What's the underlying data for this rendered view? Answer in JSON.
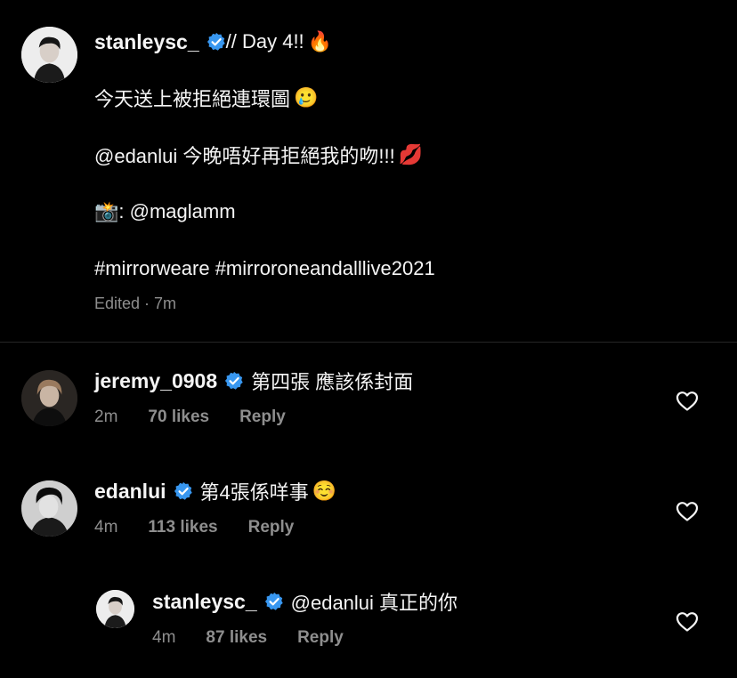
{
  "post": {
    "username": "stanleysc_",
    "title": " // Day 4!!",
    "title_emoji": "🔥",
    "line1": "今天送上被拒絕連環圖",
    "line1_emoji": "🥲",
    "line2": "@edanlui 今晚唔好再拒絕我的吻!!!",
    "line2_emoji": "💋",
    "line3_emoji": "📸",
    "line3": ": @maglamm",
    "hashtags": "#mirrorweare #mirroroneandalllive2021",
    "meta": "Edited · 7m"
  },
  "comments": [
    {
      "username": "jeremy_0908",
      "text": "第四張 應該係封面",
      "emoji": "",
      "time": "2m",
      "likes": "70 likes",
      "reply": "Reply"
    },
    {
      "username": "edanlui",
      "text": "第4張係咩事",
      "emoji": "☺️",
      "time": "4m",
      "likes": "113 likes",
      "reply": "Reply"
    },
    {
      "username": "stanleysc_",
      "text": "@edanlui 真正的你",
      "emoji": "",
      "time": "4m",
      "likes": "87 likes",
      "reply": "Reply"
    }
  ],
  "colors": {
    "background": "#000000",
    "text": "#f5f5f5",
    "muted": "#8e8e8e",
    "verified": "#3897f0",
    "divider": "#262626"
  },
  "icons": [
    "verified-badge-icon",
    "heart-icon"
  ]
}
